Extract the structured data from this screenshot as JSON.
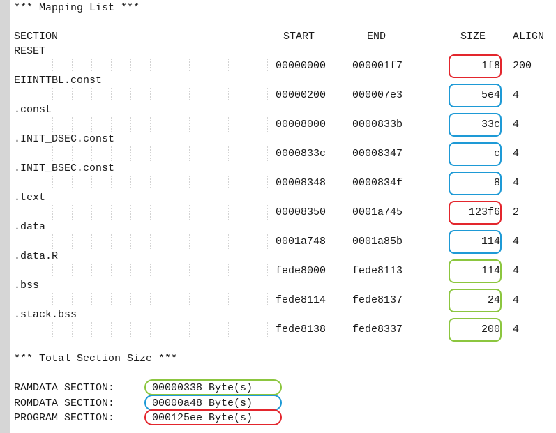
{
  "title": "*** Mapping List ***",
  "headers": {
    "section": "SECTION",
    "start": "START",
    "end": "END",
    "size": "SIZE",
    "align": "ALIGN"
  },
  "rows": [
    {
      "name": "RESET",
      "start": "00000000",
      "end": "000001f7",
      "size": "1f8",
      "align": "200",
      "box": "#e3262d"
    },
    {
      "name": "EIINTTBL.const",
      "start": "00000200",
      "end": "000007e3",
      "size": "5e4",
      "align": "4",
      "box": "#1e9ad6"
    },
    {
      "name": ".const",
      "start": "00008000",
      "end": "0000833b",
      "size": "33c",
      "align": "4",
      "box": "#1e9ad6"
    },
    {
      "name": ".INIT_DSEC.const",
      "start": "0000833c",
      "end": "00008347",
      "size": "c",
      "align": "4",
      "box": "#1e9ad6"
    },
    {
      "name": ".INIT_BSEC.const",
      "start": "00008348",
      "end": "0000834f",
      "size": "8",
      "align": "4",
      "box": "#1e9ad6"
    },
    {
      "name": ".text",
      "start": "00008350",
      "end": "0001a745",
      "size": "123f6",
      "align": "2",
      "box": "#e3262d"
    },
    {
      "name": ".data",
      "start": "0001a748",
      "end": "0001a85b",
      "size": "114",
      "align": "4",
      "box": "#1e9ad6"
    },
    {
      "name": ".data.R",
      "start": "fede8000",
      "end": "fede8113",
      "size": "114",
      "align": "4",
      "box": "#8cc63f"
    },
    {
      "name": ".bss",
      "start": "fede8114",
      "end": "fede8137",
      "size": "24",
      "align": "4",
      "box": "#8cc63f"
    },
    {
      "name": ".stack.bss",
      "start": "fede8138",
      "end": "fede8337",
      "size": "200",
      "align": "4",
      "box": "#8cc63f"
    }
  ],
  "total_title": "*** Total Section Size ***",
  "totals": [
    {
      "label": "RAMDATA SECTION:",
      "value": "00000338 Byte(s)",
      "box": "#8cc63f"
    },
    {
      "label": "ROMDATA SECTION:",
      "value": "00000a48 Byte(s)",
      "box": "#1e9ad6"
    },
    {
      "label": "PROGRAM SECTION:",
      "value": "000125ee Byte(s)",
      "box": "#e3262d"
    }
  ]
}
